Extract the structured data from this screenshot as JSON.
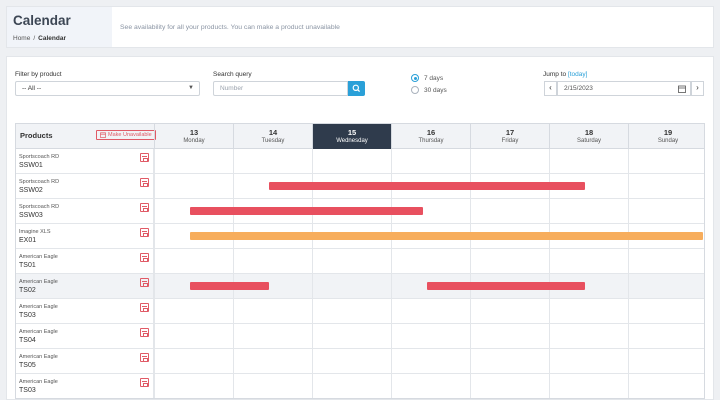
{
  "header": {
    "title": "Calendar",
    "breadcrumb": [
      "Home",
      "/",
      "Calendar"
    ],
    "description": "See availability for all your products. You can make a product unavailable"
  },
  "filters": {
    "product_label": "Filter by product",
    "product_value": "-- All --",
    "query_label": "Search query",
    "query_placeholder": "Number",
    "radio_options": [
      {
        "label": "7 days",
        "selected": true
      },
      {
        "label": "30 days",
        "selected": false
      }
    ],
    "jump_label": "Jump to ",
    "today_link": "[today]",
    "date_value": "2/15/2023",
    "prev_label": "‹",
    "next_label": "›"
  },
  "calendar": {
    "products_title": "Products",
    "make_unavailable_label": "Make Unavailable",
    "days": [
      {
        "num": "13",
        "name": "Monday",
        "active": false
      },
      {
        "num": "14",
        "name": "Tuesday",
        "active": false
      },
      {
        "num": "15",
        "name": "Wednesday",
        "active": true
      },
      {
        "num": "16",
        "name": "Thursday",
        "active": false
      },
      {
        "num": "17",
        "name": "Friday",
        "active": false
      },
      {
        "num": "18",
        "name": "Saturday",
        "active": false
      },
      {
        "num": "19",
        "name": "Sunday",
        "active": false
      }
    ],
    "rows": [
      {
        "brand": "Sportscoach RD",
        "sku": "SSW01",
        "highlight": false
      },
      {
        "brand": "Sportscoach RD",
        "sku": "SSW02",
        "highlight": false
      },
      {
        "brand": "Sportscoach RD",
        "sku": "SSW03",
        "highlight": false
      },
      {
        "brand": "Imagine XLS",
        "sku": "EX01",
        "highlight": false
      },
      {
        "brand": "American Eagle",
        "sku": "TS01",
        "highlight": false
      },
      {
        "brand": "American Eagle",
        "sku": "TS02",
        "highlight": true
      },
      {
        "brand": "American Eagle",
        "sku": "TS03",
        "highlight": false
      },
      {
        "brand": "American Eagle",
        "sku": "TS04",
        "highlight": false
      },
      {
        "brand": "American Eagle",
        "sku": "TS05",
        "highlight": false
      },
      {
        "brand": "American Eagle",
        "sku": "TS03",
        "highlight": false
      }
    ],
    "bookings": [
      {
        "row": 1,
        "start_day": 14.45,
        "end_day": 18.45,
        "color": "#e8505f"
      },
      {
        "row": 2,
        "start_day": 13.45,
        "end_day": 16.4,
        "color": "#e8505f"
      },
      {
        "row": 3,
        "start_day": 13.45,
        "end_day": 19.95,
        "color": "#f7ad5c"
      },
      {
        "row": 5,
        "start_day": 13.45,
        "end_day": 14.45,
        "color": "#e8505f"
      },
      {
        "row": 5,
        "start_day": 16.45,
        "end_day": 18.45,
        "color": "#e8505f"
      }
    ]
  },
  "colors": {
    "accent": "#2aa0d8",
    "active_day": "#2f3b4c",
    "booking_red": "#e8505f",
    "booking_orange": "#f7ad5c"
  }
}
